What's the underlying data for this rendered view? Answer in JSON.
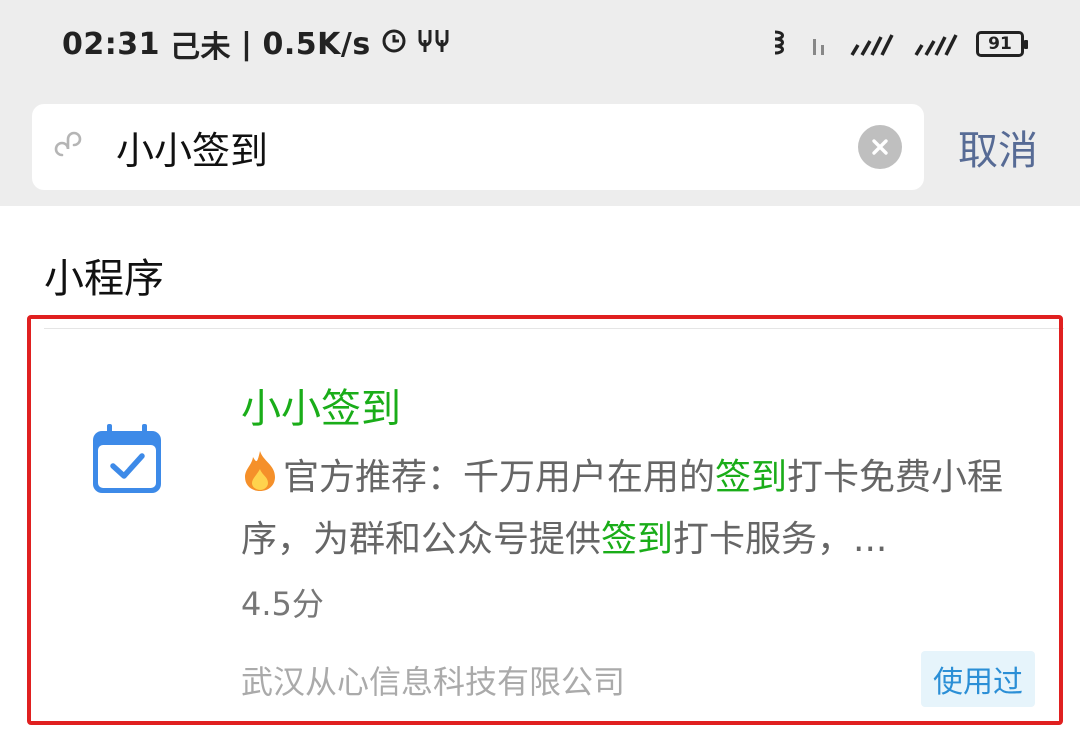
{
  "status_bar": {
    "time": "02:31",
    "lunar": "己未",
    "separator": "|",
    "net_speed": "0.5K/s",
    "battery": "91"
  },
  "search": {
    "query": "小小签到",
    "placeholder": "",
    "cancel_label": "取消"
  },
  "section": {
    "title": "小程序"
  },
  "result": {
    "name": "小小签到",
    "desc_1": "官方推荐：千万用户在用的",
    "desc_hl_1": "签到",
    "desc_2": "打卡免费小程序，为群和公众号提供",
    "desc_hl_2": "签到",
    "desc_3": "打卡服务，...",
    "rating": "4.5分",
    "company": "武汉从心信息科技有限公司",
    "badge": "使用过"
  },
  "colors": {
    "accent_green": "#1aad19",
    "link_blue": "#576b95",
    "highlight_border": "#e02020",
    "icon_blue": "#3d8ae8"
  },
  "icons": [
    "alarm-icon",
    "hd-icon",
    "vibrate-icon",
    "signal-icon",
    "mini-program-icon",
    "clear-icon",
    "calendar-check-icon",
    "fire-icon"
  ]
}
